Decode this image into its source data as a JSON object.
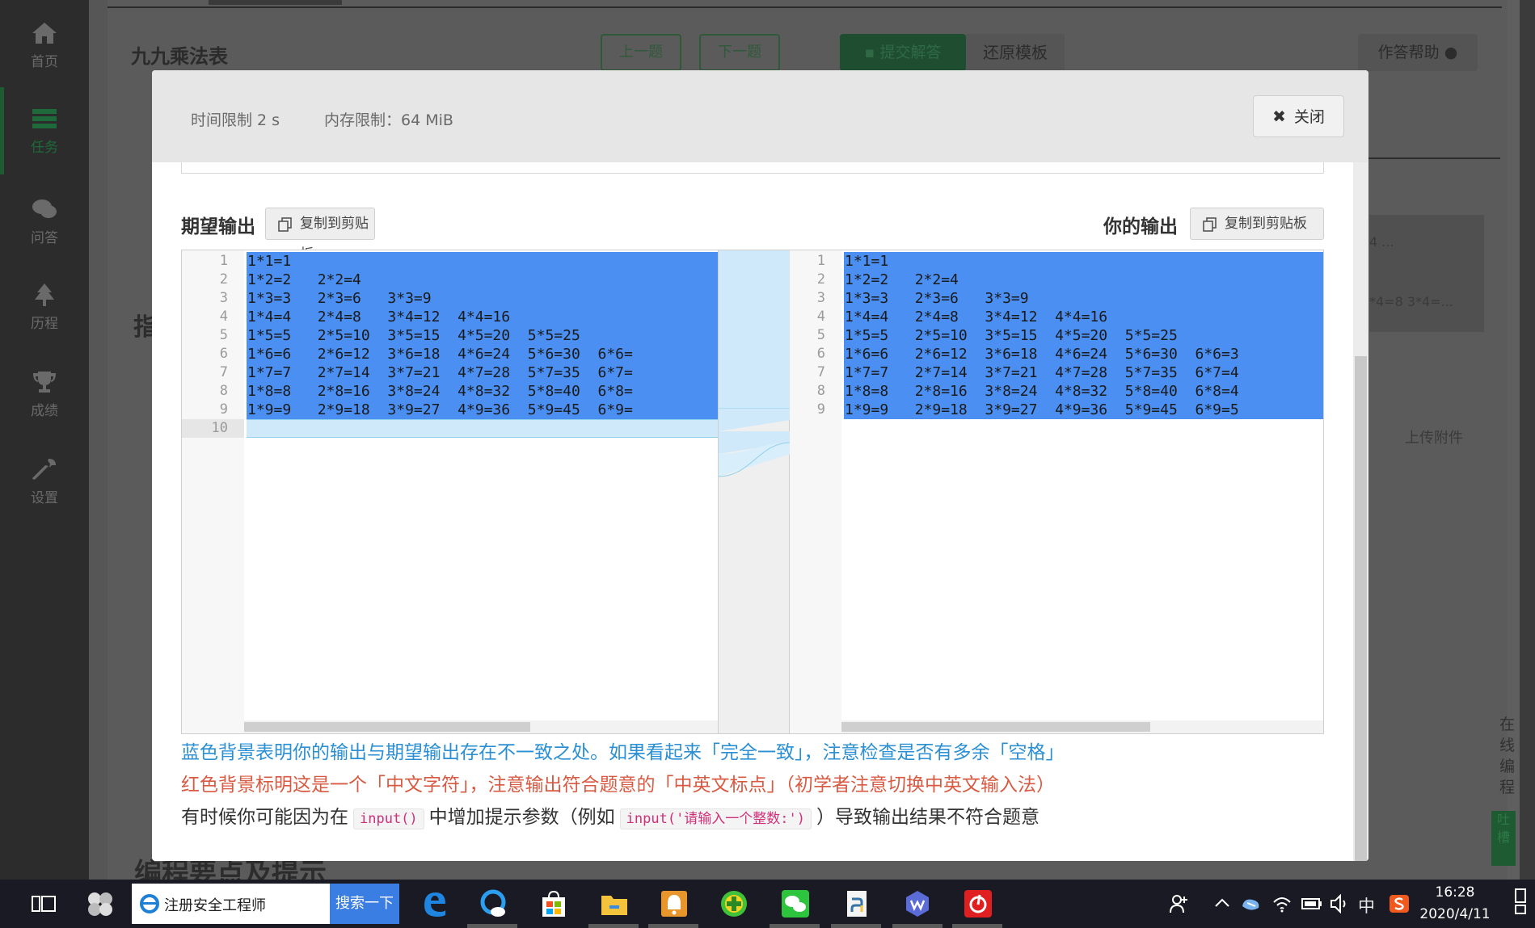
{
  "sidebar": {
    "items": [
      {
        "label": "首页",
        "icon": "home-icon"
      },
      {
        "label": "任务",
        "icon": "list-icon"
      },
      {
        "label": "问答",
        "icon": "chat-icon"
      },
      {
        "label": "历程",
        "icon": "tree-icon"
      },
      {
        "label": "成绩",
        "icon": "trophy-icon"
      },
      {
        "label": "设置",
        "icon": "wrench-icon"
      }
    ],
    "active": "任务"
  },
  "background": {
    "title": "九九乘法表",
    "prev_label": "上一题",
    "next_label": "下一题",
    "submit_label": "提交解答",
    "restore_label": "还原模板",
    "help_label": "作答帮助",
    "panel_text_1": "4 ...",
    "panel_text_2": "*4=8 3*4=...",
    "upload_label": "上传附件",
    "online_label": "在线编程",
    "green_label": "吐槽",
    "bottom_heading": "编程要点及提示",
    "side_glyph": "指"
  },
  "modal": {
    "time_limit": "时间限制 2 s",
    "memory_limit": "内存限制：64 MiB",
    "close_label": "关闭",
    "expected_title": "期望输出",
    "yours_title": "你的输出",
    "copy_label": "复制到剪贴板",
    "expected_lines": [
      "1*1=1",
      "1*2=2   2*2=4",
      "1*3=3   2*3=6   3*3=9",
      "1*4=4   2*4=8   3*4=12  4*4=16",
      "1*5=5   2*5=10  3*5=15  4*5=20  5*5=25",
      "1*6=6   2*6=12  3*6=18  4*6=24  5*6=30  6*6=",
      "1*7=7   2*7=14  3*7=21  4*7=28  5*7=35  6*7=",
      "1*8=8   2*8=16  3*8=24  4*8=32  5*8=40  6*8=",
      "1*9=9   2*9=18  3*9=27  4*9=36  5*9=45  6*9=",
      ""
    ],
    "yours_lines": [
      "1*1=1",
      "1*2=2   2*2=4",
      "1*3=3   2*3=6   3*3=9",
      "1*4=4   2*4=8   3*4=12  4*4=16",
      "1*5=5   2*5=10  3*5=15  4*5=20  5*5=25",
      "1*6=6   2*6=12  3*6=18  4*6=24  5*6=30  6*6=3",
      "1*7=7   2*7=14  3*7=21  4*7=28  5*7=35  6*7=4",
      "1*8=8   2*8=16  3*8=24  4*8=32  5*8=40  6*8=4",
      "1*9=9   2*9=18  3*9=27  4*9=36  5*9=45  6*9=5"
    ],
    "note_blue": "蓝色背景表明你的输出与期望输出存在不一致之处。如果看起来「完全一致」，注意检查是否有多余「空格」",
    "note_red": "红色背景标明这是一个「中文字符」，注意输出符合题意的「中英文标点」（初学者注意切换中英文输入法）",
    "note_gray_1": "有时候你可能因为在",
    "note_gray_code_1": "input()",
    "note_gray_2": "中增加提示参数（例如",
    "note_gray_code_2": "input('请输入一个整数:')",
    "note_gray_3": "）导致输出结果不符合题意"
  },
  "taskbar": {
    "search_text": "注册安全工程师",
    "search_button": "搜索一下",
    "ime": "中",
    "time": "16:28",
    "date": "2020/4/11"
  },
  "colors": {
    "diff_highlight": "#4a8ff1",
    "diff_empty": "#cfe9fb",
    "note_blue": "#2a8fd3",
    "note_red": "#d85a42"
  }
}
